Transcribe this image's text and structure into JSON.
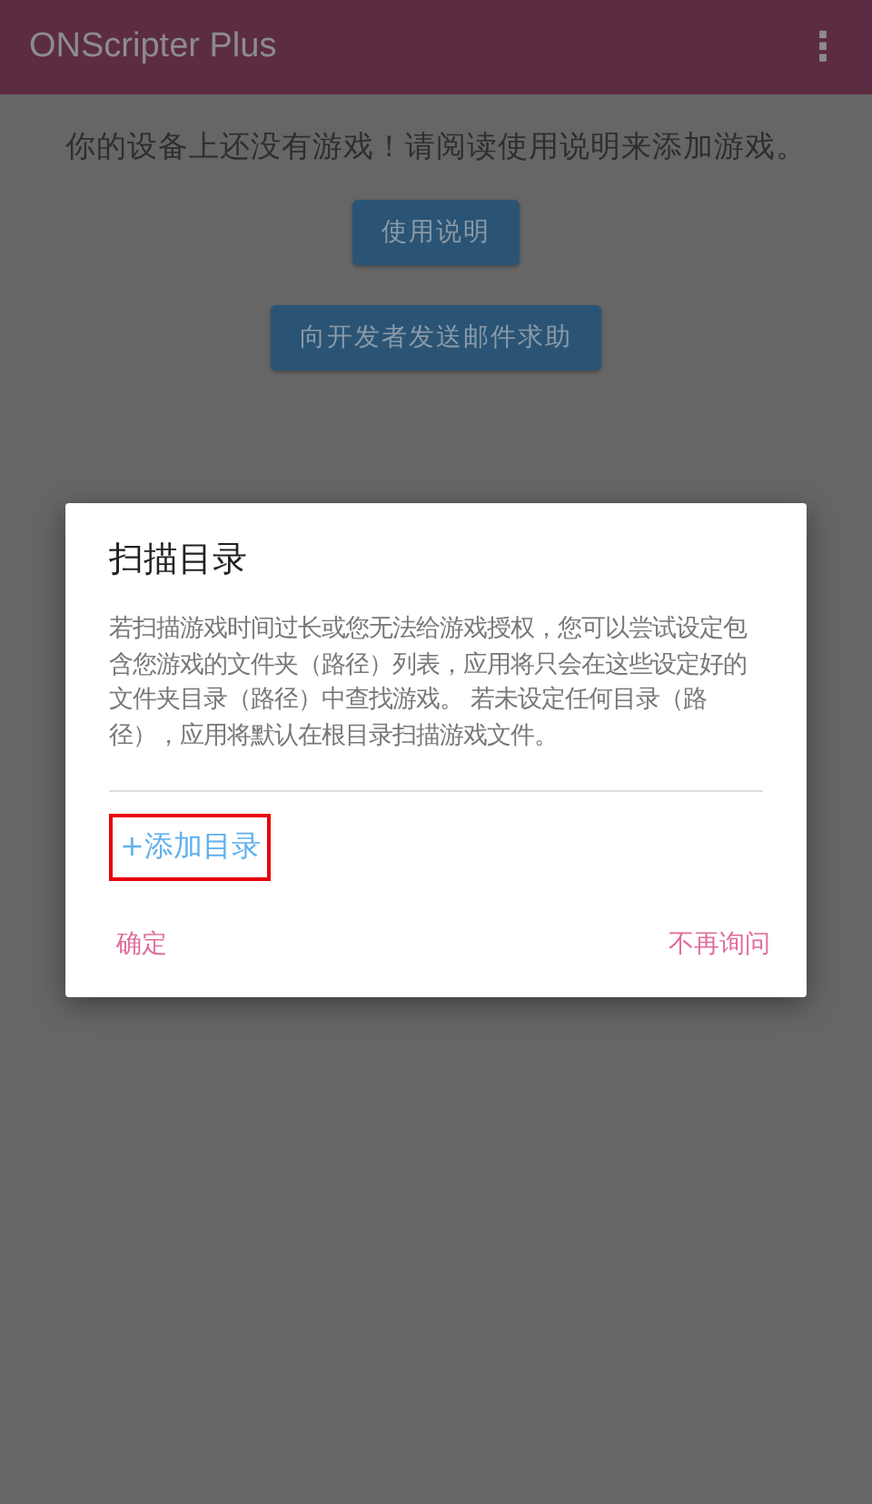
{
  "app_bar": {
    "title": "ONScripter Plus",
    "menu_icon": "⋮"
  },
  "home": {
    "message": "你的设备上还没有游戏！请阅读使用说明来添加游戏。",
    "buttons": [
      "使用说明",
      "向开发者发送邮件求助"
    ]
  },
  "dialog": {
    "title": "扫描目录",
    "message": "若扫描游戏时间过长或您无法给游戏授权，您可以尝试设定包含您游戏的文件夹（路径）列表，应用将只会在这些设定好的文件夹目录（路径）中查找游戏。 若未设定任何目录（路径），应用将默认在根目录扫描游戏文件。",
    "add_folder": {
      "label": "+添加目录",
      "highlighted": true
    },
    "actions": [
      "确定",
      "不再询问"
    ]
  }
}
